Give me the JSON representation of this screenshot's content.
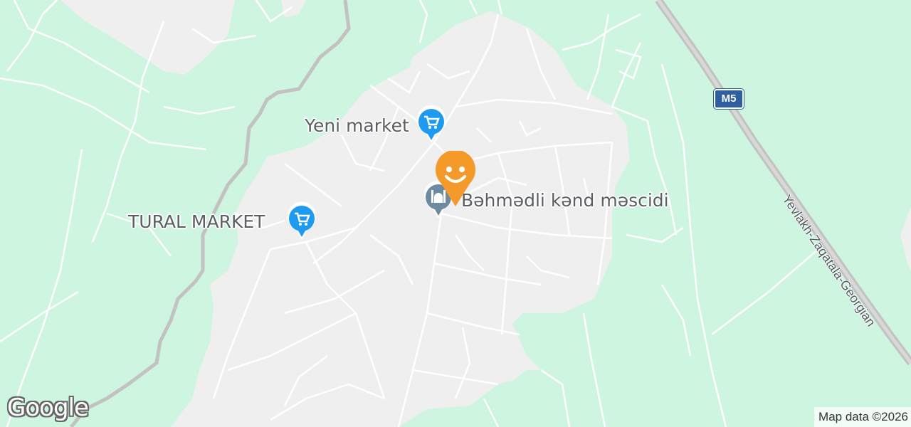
{
  "map": {
    "colors": {
      "land": "#cdf5df",
      "settlement": "#efefef",
      "road": "#ffffff",
      "waterway": "#c2c2c2",
      "highway": "#c2c2c2"
    }
  },
  "places": [
    {
      "label": "Yeni market",
      "icon": "shopping-cart-icon",
      "color": "#1e9bf0"
    },
    {
      "label": "TURAL MARKET",
      "icon": "shopping-cart-icon",
      "color": "#1e9bf0"
    },
    {
      "label": "Bəhmədli kənd məscidi",
      "icon": "mosque-icon",
      "color": "#6e8aa0"
    }
  ],
  "road_shield": {
    "label": "M5",
    "color": "#2f5fa3"
  },
  "road_name": "Yevlakh-Zaqatala-Georgian",
  "user_marker": {
    "icon": "smiley-face-icon",
    "color": "#f39a2b"
  },
  "logo_text": "Google",
  "attribution": "Map data ©2026"
}
